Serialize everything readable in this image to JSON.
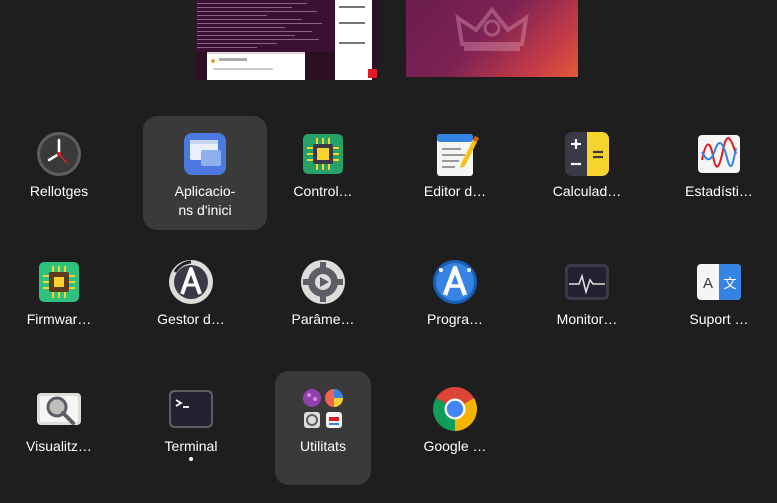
{
  "apps": [
    {
      "name": "Rellotges",
      "icon": "clock-icon"
    },
    {
      "name": "Aplicacio-\nns d'inici",
      "icon": "startup-applications-icon"
    },
    {
      "name": "Control…",
      "icon": "chip-control-icon"
    },
    {
      "name": "Editor d…",
      "icon": "text-editor-icon"
    },
    {
      "name": "Calculad…",
      "icon": "calculator-icon"
    },
    {
      "name": "Estadísti…",
      "icon": "statistics-icon"
    },
    {
      "name": "Firmwar…",
      "icon": "firmware-chip-icon"
    },
    {
      "name": "Gestor d…",
      "icon": "software-updater-icon"
    },
    {
      "name": "Parâme…",
      "icon": "settings-gear-icon"
    },
    {
      "name": "Progra…",
      "icon": "app-store-icon"
    },
    {
      "name": "Monitor…",
      "icon": "system-monitor-icon"
    },
    {
      "name": "Suport …",
      "icon": "language-support-icon"
    },
    {
      "name": "Visualitz…",
      "icon": "image-viewer-icon"
    },
    {
      "name": "Terminal",
      "icon": "terminal-icon"
    },
    {
      "name": "Utilitats",
      "icon": "utilities-folder-icon"
    },
    {
      "name": "Google …",
      "icon": "chrome-icon"
    }
  ],
  "colors": {
    "background": "#1e1e1e",
    "highlight": "#3a3a3a",
    "workspace_accent": "#7c2253"
  }
}
